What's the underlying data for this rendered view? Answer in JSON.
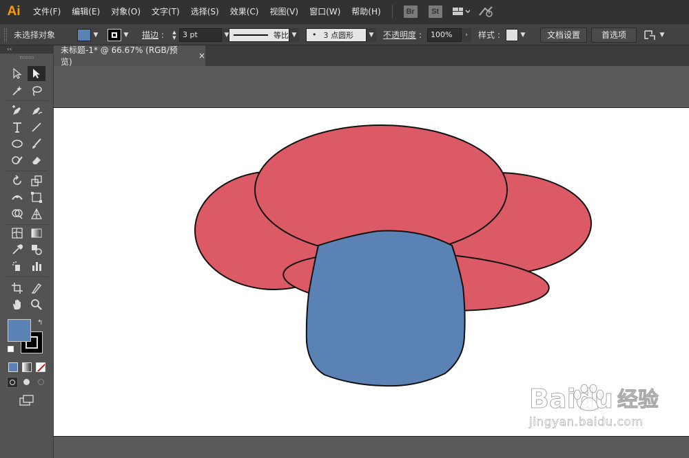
{
  "app": {
    "logo": "Ai"
  },
  "menu": [
    "文件(F)",
    "编辑(E)",
    "对象(O)",
    "文字(T)",
    "选择(S)",
    "效果(C)",
    "视图(V)",
    "窗口(W)",
    "帮助(H)"
  ],
  "menu_apps": {
    "bridge": "Br",
    "stock": "St"
  },
  "control": {
    "selection_status": "未选择对象",
    "fill_color": "#5b82b5",
    "stroke_label": "描边",
    "stroke_weight": "3 pt",
    "profile_label": "等比",
    "brush_label": "3 点圆形",
    "brush_dot": "•",
    "opacity_label": "不透明度",
    "opacity_value": "100%",
    "style_label": "样式",
    "doc_setup": "文档设置",
    "preferences": "首选项"
  },
  "document": {
    "tab_title": "未标题-1* @ 66.67% (RGB/预览)",
    "close": "×"
  },
  "tools": {
    "fill_color": "#5b82b5",
    "stroke_color": "#000000",
    "collapse": "‹‹"
  },
  "artwork": {
    "petal_color": "#dc5a66",
    "stem_color": "#5b82b5",
    "outline_color": "#111111"
  },
  "watermark": {
    "brand": "Baidu",
    "brand_cn": "经验",
    "url": "jingyan.baidu.com"
  }
}
